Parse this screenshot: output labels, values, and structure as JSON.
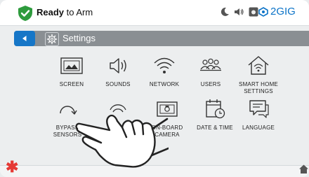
{
  "status": {
    "bold": "Ready",
    "rest": " to Arm",
    "brand": "2GIG"
  },
  "header": {
    "title": "Settings"
  },
  "grid": [
    {
      "label": "SCREEN",
      "icon": "screen-icon"
    },
    {
      "label": "SOUNDS",
      "icon": "speaker-icon"
    },
    {
      "label": "NETWORK",
      "icon": "wifi-icon"
    },
    {
      "label": "USERS",
      "icon": "users-icon"
    },
    {
      "label": "SMART HOME SETTINGS",
      "icon": "smart-home-icon"
    },
    {
      "label": "BYPASS SENSORS",
      "icon": "bypass-icon"
    },
    {
      "label": "",
      "icon": "sensor-icon"
    },
    {
      "label": "ON-BOARD CAMERA",
      "icon": "camera-icon"
    },
    {
      "label": "DATE & TIME",
      "icon": "calendar-clock-icon"
    },
    {
      "label": "LANGUAGE",
      "icon": "speech-bubble-icon"
    }
  ],
  "colors": {
    "accent": "#1676c7",
    "armed_green": "#2e9b3d",
    "alert_red": "#e53935",
    "title_bar": "#8a8f93"
  }
}
